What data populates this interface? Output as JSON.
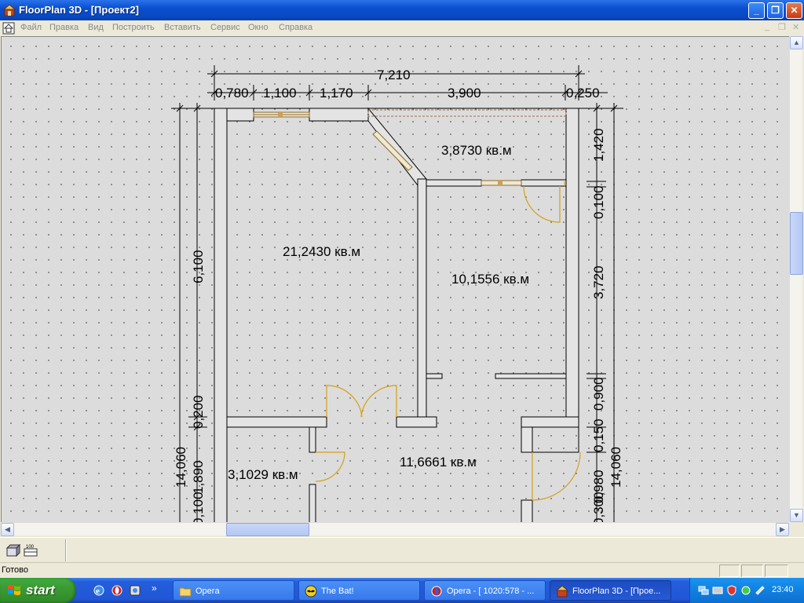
{
  "window": {
    "title": "FloorPlan 3D - [Проект2]",
    "controls": {
      "minimize": "_",
      "restore": "❐",
      "close": "✕"
    }
  },
  "menu": {
    "items": [
      "Файл",
      "Правка",
      "Вид",
      "Построить",
      "Вставить",
      "Сервис",
      "Окно",
      "Справка"
    ],
    "mdi_controls": [
      "_",
      "❐",
      "✕"
    ]
  },
  "plan": {
    "dimensions": {
      "top_total": "7,210",
      "top_segments": [
        "0,780",
        "1,100",
        "1,170",
        "3,900",
        "0,250"
      ],
      "left_outer": "14,060",
      "left_inner": "6,100",
      "left_small": "0,200",
      "left_lower": "1,890",
      "left_lower2": "0,100",
      "right_outer": "14,060",
      "right_1": "1,420",
      "right_2": "0,100",
      "right_3": "3,720",
      "right_4": "0,900",
      "right_5": "0,150",
      "right_6": "0,980",
      "right_7": "0,300"
    },
    "areas": {
      "room_a": "3,8730 кв.м",
      "room_b": "21,2430 кв.м",
      "room_c": "10,1556 кв.м",
      "room_d": "3,1029 кв.м",
      "room_e": "11,6661 кв.м"
    }
  },
  "status": {
    "text": "Готово"
  },
  "taskbar": {
    "start_label": "start",
    "tasks": [
      "Opera",
      "The Bat!",
      "Opera - [ 1020:578 - ...",
      "FloorPlan 3D - [Прое..."
    ],
    "clock": "23:40"
  },
  "colors": {
    "wall": "#000000",
    "door_arc": "#d4a017",
    "window_frame": "#c8a060",
    "taskbar": "#245edb"
  }
}
